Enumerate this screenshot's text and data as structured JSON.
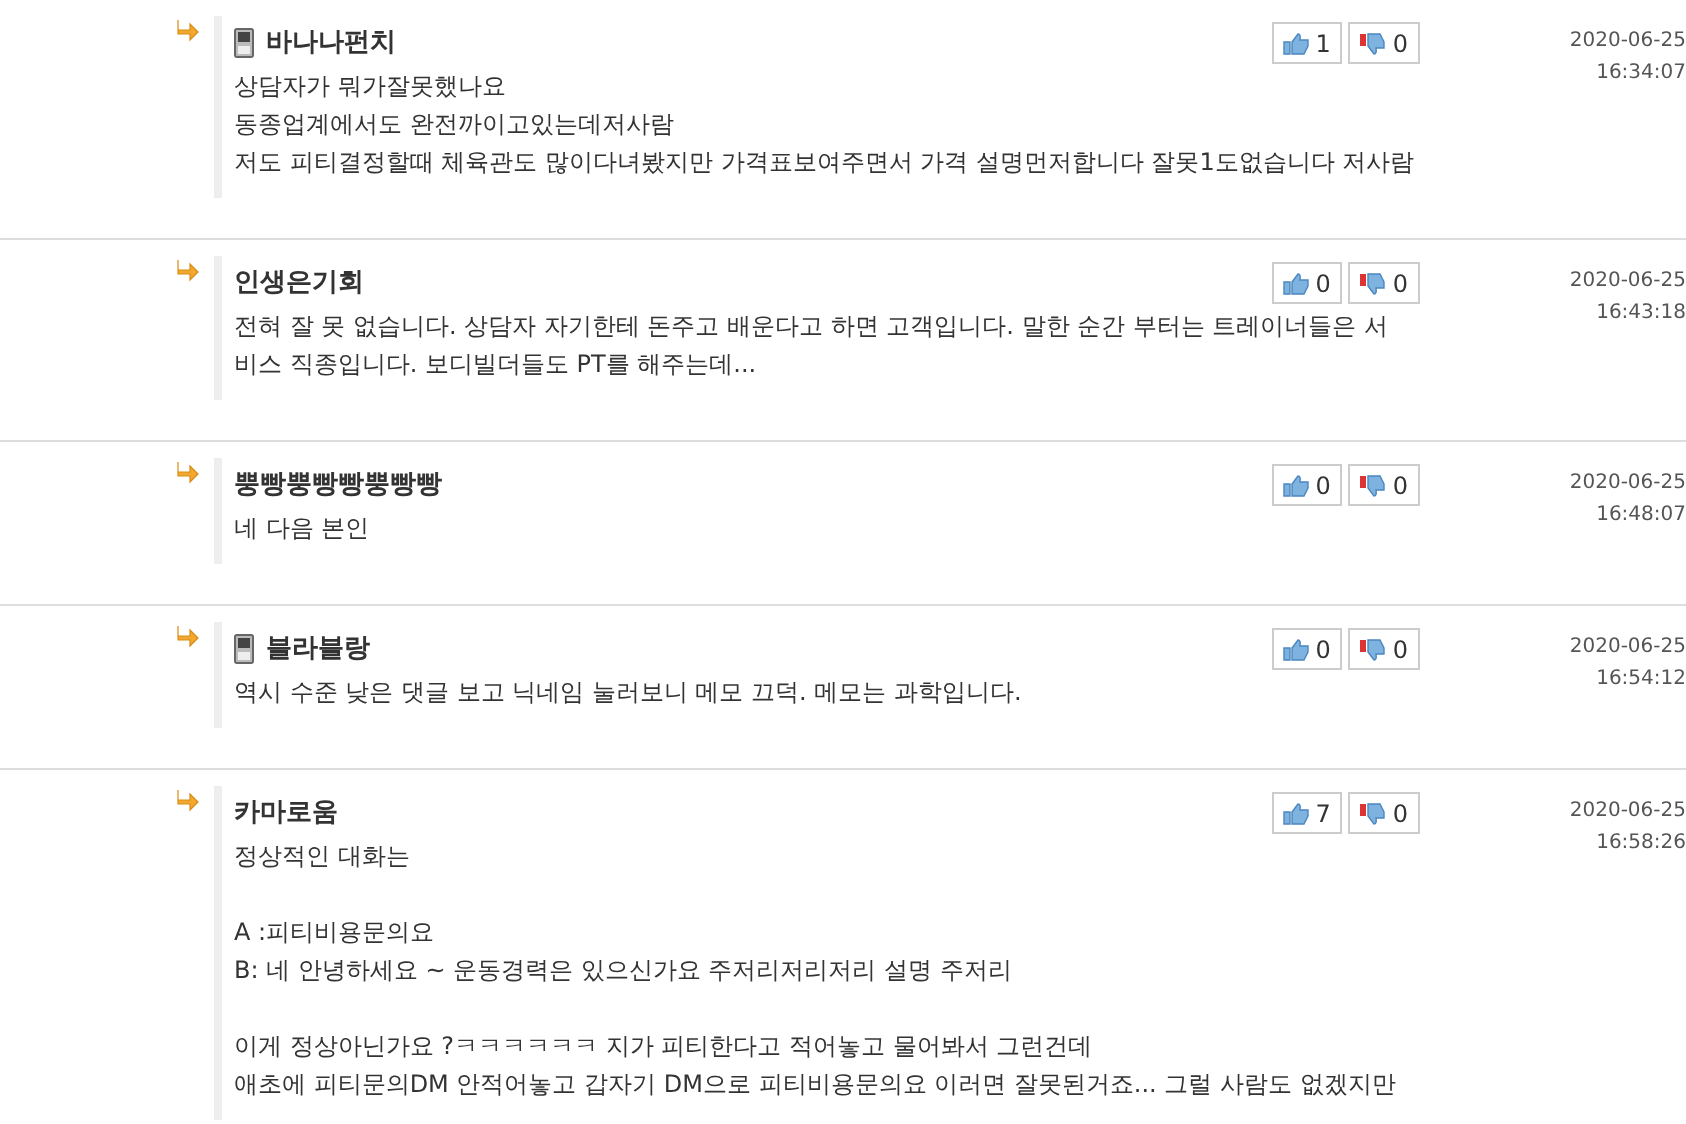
{
  "comments": [
    {
      "author": "바나나펀치",
      "mobile": true,
      "likes": "1",
      "dislikes": "0",
      "date": "2020-06-25",
      "time": "16:34:07",
      "paragraphs": [
        [
          "상담자가 뭐가잘못했나요",
          "동종업계에서도 완전까이고있는데저사람",
          "저도 피티결정할때 체육관도 많이다녀봤지만 가격표보여주면서 가격 설명먼저합니다 잘못1도없습니다 저사람"
        ]
      ]
    },
    {
      "author": "인생은기회",
      "mobile": false,
      "likes": "0",
      "dislikes": "0",
      "date": "2020-06-25",
      "time": "16:43:18",
      "paragraphs": [
        [
          "전혀 잘 못 없습니다. 상담자  자기한테 돈주고 배운다고 하면 고객입니다. 말한 순간 부터는 트레이너들은 서",
          "비스 직종입니다. 보디빌더들도 PT를 해주는데..."
        ]
      ]
    },
    {
      "author": "뿡빵뿡빵빵뿡빵빵",
      "mobile": false,
      "likes": "0",
      "dislikes": "0",
      "date": "2020-06-25",
      "time": "16:48:07",
      "paragraphs": [
        [
          "네 다음 본인"
        ]
      ]
    },
    {
      "author": "블라블랑",
      "mobile": true,
      "likes": "0",
      "dislikes": "0",
      "date": "2020-06-25",
      "time": "16:54:12",
      "paragraphs": [
        [
          "역시 수준 낮은 댓글 보고 닉네임 눌러보니 메모 끄덕. 메모는 과학입니다."
        ]
      ]
    },
    {
      "author": "카마로움",
      "mobile": false,
      "likes": "7",
      "dislikes": "0",
      "date": "2020-06-25",
      "time": "16:58:26",
      "paragraphs": [
        [
          "정상적인 대화는"
        ],
        [
          "A :피티비용문의요",
          "B: 네 안녕하세요 ~ 운동경력은 있으신가요 주저리저리저리 설명 주저리"
        ],
        [
          "이게 정상아닌가요 ?ㅋㅋㅋㅋㅋㅋ 지가 피티한다고 적어놓고 물어봐서 그런건데",
          "애초에 피티문의DM 안적어놓고 갑자기 DM으로 피티비용문의요 이러면 잘못된거죠... 그럴 사람도 없겠지만"
        ]
      ]
    }
  ]
}
